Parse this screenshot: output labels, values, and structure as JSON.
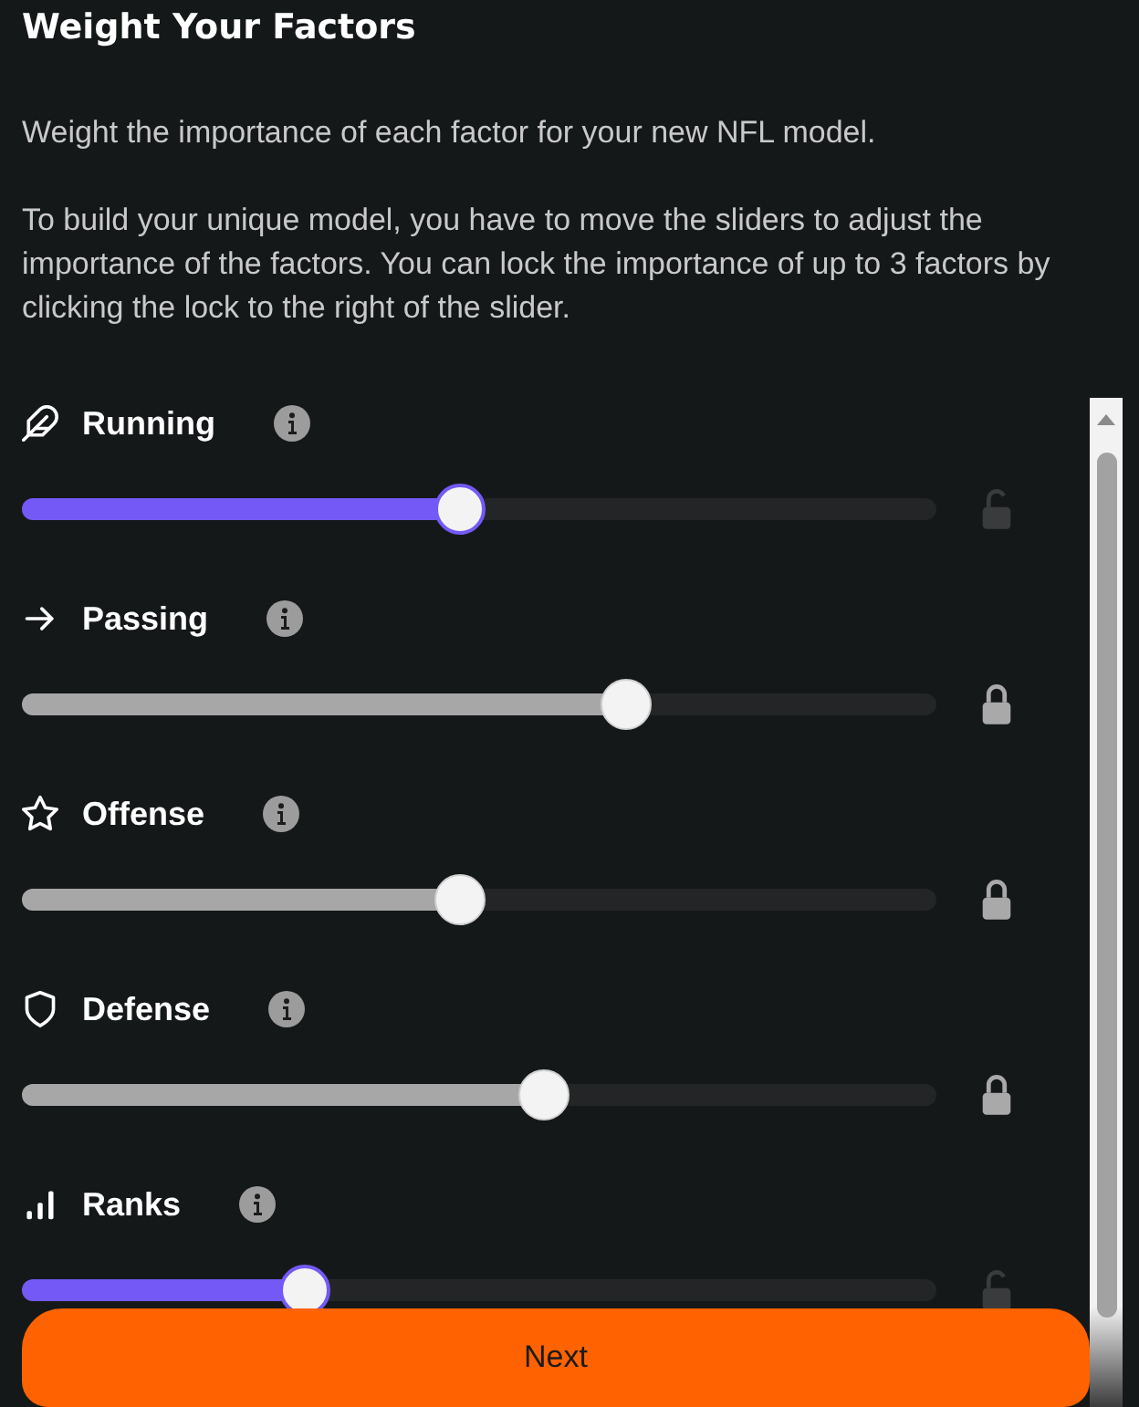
{
  "title": "Weight Your Factors",
  "intro": [
    "Weight the importance of each factor for your new NFL model.",
    "To build your unique model, you have to move the sliders to adjust the importance of the factors. You can lock the importance of up to 3 factors by clicking the lock to the right of the slider."
  ],
  "factors": [
    {
      "name": "Running",
      "level": 0.48,
      "locked": false
    },
    {
      "name": "Passing",
      "level": 0.66,
      "locked": true
    },
    {
      "name": "Offense",
      "level": 0.48,
      "locked": true
    },
    {
      "name": "Defense",
      "level": 0.57,
      "locked": true
    },
    {
      "name": "Ranks",
      "level": 0.31,
      "locked": false
    }
  ],
  "next_button": {
    "label": "Next"
  }
}
